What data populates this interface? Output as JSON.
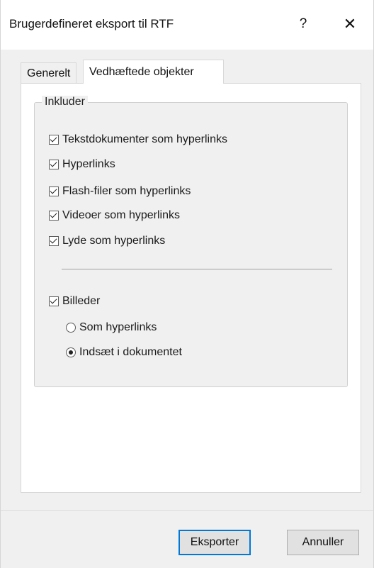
{
  "window": {
    "title": "Brugerdefineret eksport til RTF",
    "help_label": "?",
    "close_label": "✕"
  },
  "tabs": [
    {
      "label": "Generelt",
      "selected": false
    },
    {
      "label": "Vedhæftede objekter",
      "selected": true
    }
  ],
  "include_group": {
    "label": "Inkluder",
    "options": [
      {
        "label": "Tekstdokumenter som hyperlinks",
        "checked": true
      },
      {
        "label": "Hyperlinks",
        "checked": true
      },
      {
        "label": "Flash-filer som hyperlinks",
        "checked": true
      },
      {
        "label": "Videoer som hyperlinks",
        "checked": true
      },
      {
        "label": "Lyde som hyperlinks",
        "checked": true
      }
    ],
    "images": {
      "label": "Billeder",
      "checked": true,
      "radio_options": [
        {
          "label": "Som hyperlinks",
          "selected": false
        },
        {
          "label": "Indsæt i dokumentet",
          "selected": true
        }
      ]
    }
  },
  "buttons": {
    "export_label": "Eksporter",
    "cancel_label": "Annuller"
  }
}
